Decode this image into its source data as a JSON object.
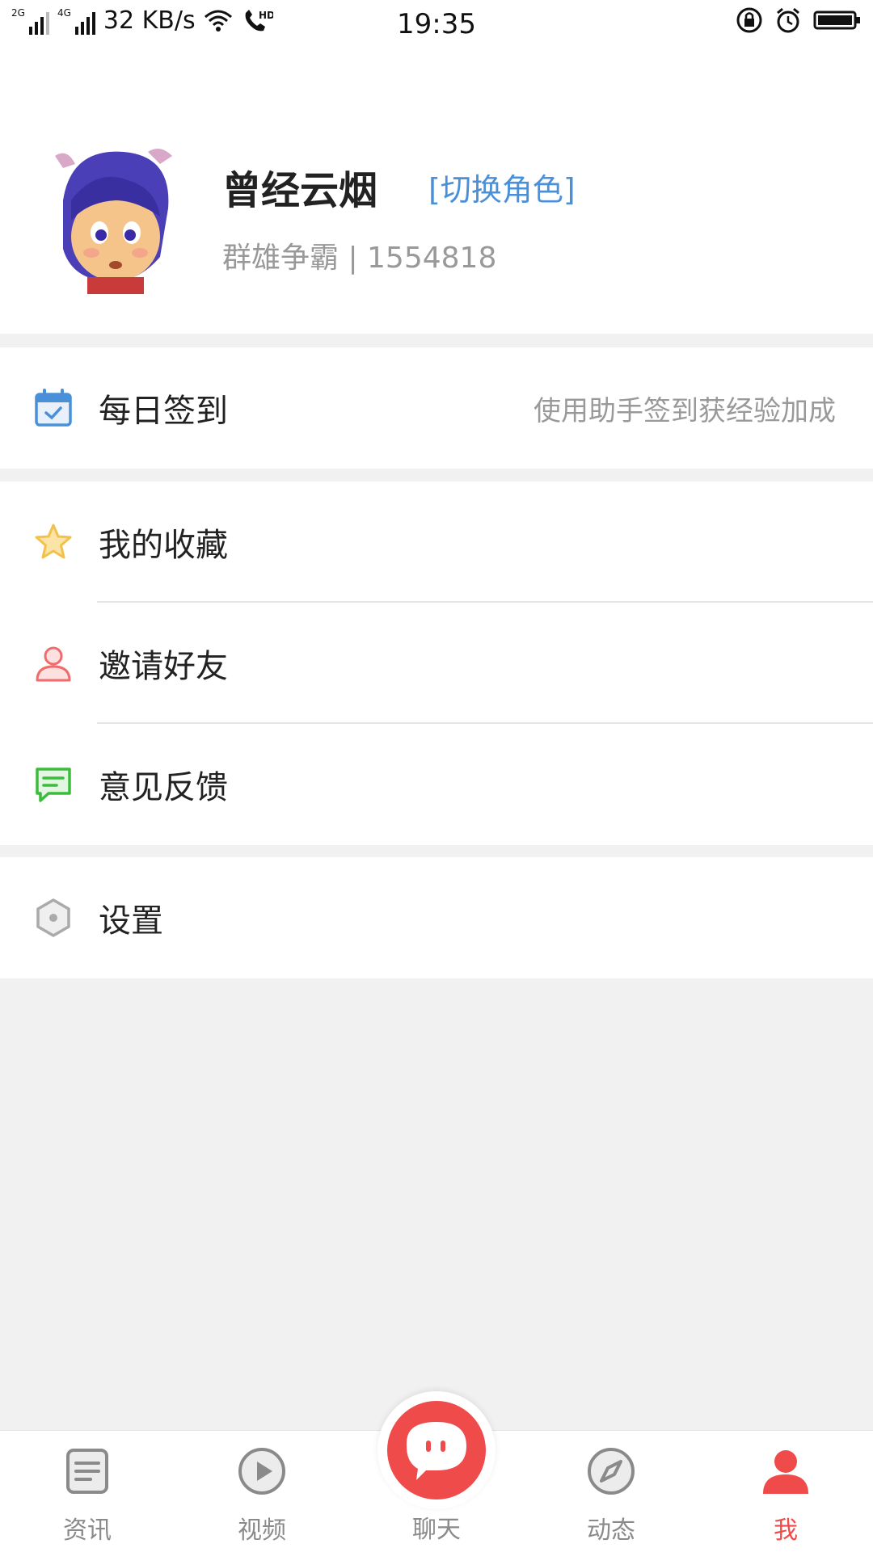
{
  "status_bar": {
    "net1": "2G",
    "net2": "4G",
    "speed": "32 KB/s",
    "hd": "HD",
    "time": "19:35"
  },
  "profile": {
    "name": "曾经云烟",
    "switch_role": "[切换角色]",
    "server_and_id": "群雄争霸 | 1554818"
  },
  "sections": {
    "checkin": {
      "label": "每日签到",
      "hint": "使用助手签到获经验加成"
    },
    "favorites": {
      "label": "我的收藏"
    },
    "invite": {
      "label": "邀请好友"
    },
    "feedback": {
      "label": "意见反馈"
    },
    "settings": {
      "label": "设置"
    }
  },
  "bottom_nav": {
    "news": "资讯",
    "video": "视频",
    "chat": "聊天",
    "moments": "动态",
    "me": "我"
  },
  "colors": {
    "accent": "#f04b4b",
    "link": "#4a90d9",
    "checkin_icon": "#4a90d9",
    "favorite_icon": "#f3c14b",
    "invite_icon": "#f06b6b",
    "feedback_icon": "#3dbb3d",
    "settings_icon": "#aaaaaa"
  }
}
